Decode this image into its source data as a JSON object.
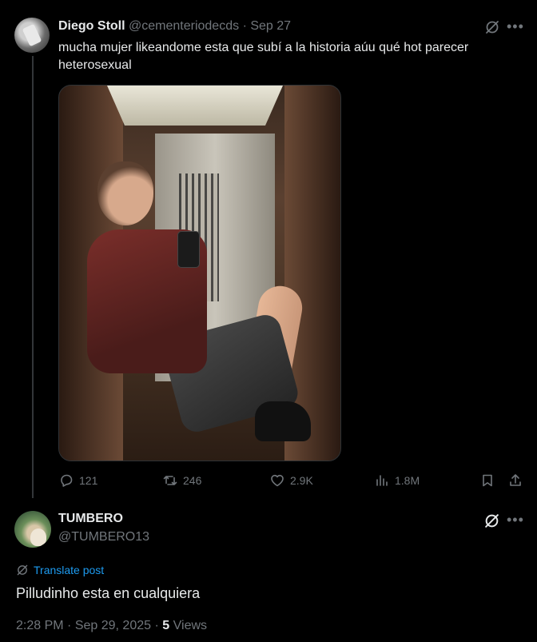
{
  "original_tweet": {
    "author_name": "Diego Stoll",
    "handle": "@cementeriodecds",
    "separator": "·",
    "date": "Sep 27",
    "text": "mucha mujer likeandome esta que subí a la historia aúu qué hot parecer heterosexual",
    "icons": {
      "grok": "grok-icon",
      "more": "more-icon"
    },
    "stats": {
      "replies": "121",
      "reposts": "246",
      "likes": "2.9K",
      "views": "1.8M"
    }
  },
  "reply": {
    "author_name": "TUMBERO",
    "handle": "@TUMBERO13",
    "translate_label": "Translate post",
    "text": "Pilludinho esta en cualquiera",
    "time": "2:28 PM",
    "date": "Sep 29, 2025",
    "views_count": "5",
    "views_label": "Views"
  },
  "colors": {
    "background": "#000000",
    "text": "#e7e9ea",
    "muted": "#71767b",
    "accent": "#1d9bf0"
  }
}
